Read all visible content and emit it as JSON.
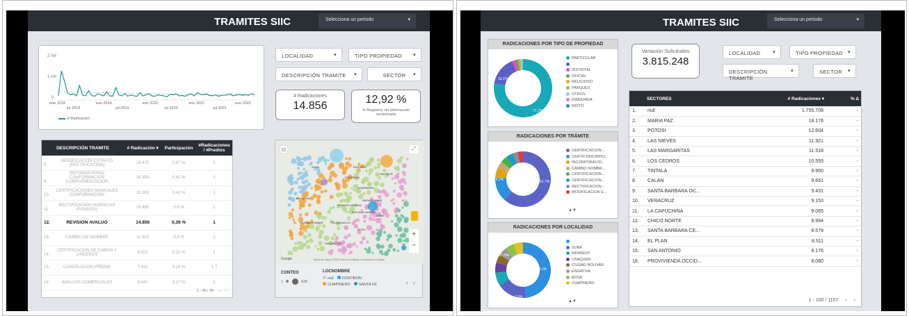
{
  "left": {
    "title": "TRAMITES SIIC",
    "period_placeholder": "Selecciona un periodo",
    "chart": {
      "y_ticks": [
        "2 mil",
        "1 mil",
        "0"
      ],
      "x_ticks": [
        "ene 2018",
        "ene 2019",
        "ene 2020",
        "ene 2021",
        "ene 2022"
      ],
      "x_ticks2": [
        "jul 2018",
        "jul 2019",
        "jul 2020",
        "jul 2021"
      ],
      "legend": "# Radicación",
      "series_color": "#1a9a8f"
    },
    "filters": {
      "localidad": "LOCALIDAD",
      "tipo": "TIPO PROPIEDAD",
      "descripcion": "DESCRIPCIÓN TRAMITE",
      "sector": "SECTOR"
    },
    "kpi1": {
      "label": "# Radicaciones",
      "value": "14.856"
    },
    "kpi2": {
      "value": "12,92 %",
      "label": "% Registros sin información sectorizada"
    },
    "table": {
      "headers": [
        "DESCRIPCIÓN TRAMITE",
        "# Radicación ▾",
        "Participación",
        "#Radicaciones / #Predios"
      ],
      "rows": [
        {
          "n": "8.",
          "d": "MODIFICACION ESTRATO (RECTIFICACION)",
          "r": "18.470",
          "p": "0,67 %",
          "x": "1",
          "hl": false
        },
        {
          "n": "9.",
          "d": "REFORMA PH/NO CONFORMACION COMPLEMENTACION",
          "r": "16.384",
          "p": "0,42 %",
          "x": "1",
          "hl": false
        },
        {
          "n": "10.",
          "d": "CERTIFICACIONES MANUALES CONFORMACION",
          "r": "15.309",
          "p": "0,42 %",
          "x": "1",
          "hl": false
        },
        {
          "n": "11.",
          "d": "RECTIFICACION VIGENCIAS (RANGOS)",
          "r": "15.465",
          "p": "0,4 %",
          "x": "1",
          "hl": false
        },
        {
          "n": "12.",
          "d": "REVISION AVALUO",
          "r": "14.856",
          "p": "0,39 %",
          "x": "1",
          "hl": true
        },
        {
          "n": "13.",
          "d": "CAMBIO DE NOMBRE",
          "r": "11.923",
          "p": "0,3 %",
          "x": "1",
          "hl": false
        },
        {
          "n": "14.",
          "d": "CERTIFICACION DE CABIDA Y LINDEROS",
          "r": "8.322",
          "p": "0,22 %",
          "x": "1",
          "hl": false
        },
        {
          "n": "15.",
          "d": "CANCELACION PREDIO",
          "r": "7.410",
          "p": "0,19 %",
          "x": "1,7",
          "hl": false
        },
        {
          "n": "16.",
          "d": "AVALUOS COMERCIALES",
          "r": "6.447",
          "p": "0,17 %",
          "x": "1",
          "hl": false
        }
      ],
      "pager": "1 - 36 / 36"
    },
    "map": {
      "labels": [
        "SUBA",
        "ENGATIVA",
        "FONTIBON",
        "KENNEDY",
        "PUENTE ARANDA",
        "TEUSAQUILLO",
        "CHAPINERO",
        "SANTA FE",
        "USME",
        "TUNJUELITO",
        "BOSA",
        "CIUDAD BOLIVAR",
        "ANTONIO NARIÑO",
        "RAFAEL URIBE"
      ],
      "conteo_label": "CONTEO",
      "conteo_min": "1",
      "conteo_max": "428",
      "locnombre_label": "LOCNOMBRE",
      "legend": [
        {
          "name": "null",
          "color": "#c8c8c8"
        },
        {
          "name": "FONTIBON",
          "color": "#2aa1d8"
        },
        {
          "name": "CHAPINERO",
          "color": "#f29b1f"
        },
        {
          "name": "SANTA FE",
          "color": "#1f9aa8"
        }
      ],
      "attribution": "Datos del mapa ©2023  Términos   Notificar un problema con Maps"
    }
  },
  "right": {
    "title": "TRAMITES SIIC",
    "period_placeholder": "Selecciona un periodo",
    "panel1": {
      "title": "RADICACIONES POR TIPO DE PROPIEDAD",
      "legend": [
        {
          "name": "PARTICULAR",
          "color": "#17a9b8"
        },
        {
          "name": "",
          "color": "#5a5fc8"
        },
        {
          "name": "DISTRITAL",
          "color": "#e04ec8"
        },
        {
          "name": "OFICIAL",
          "color": "#55b04a"
        },
        {
          "name": "RELIGIOSO",
          "color": "#e6a32e"
        },
        {
          "name": "PARQUES",
          "color": "#7ac36a"
        },
        {
          "name": "OTROS",
          "color": "#8bc8e8"
        },
        {
          "name": "EMBAJADA",
          "color": "#d97ad8"
        },
        {
          "name": "MIXTO",
          "color": "#2f7fd0"
        }
      ],
      "pct_big": "77,7%",
      "pct_small": "16,1%"
    },
    "panel2": {
      "title": "RADICACIONES POR TRÁMITE",
      "legend": [
        {
          "name": "CERTIFICACION...",
          "color": "#5b63c4"
        },
        {
          "name": "CERTIF.INSCRIPCI...",
          "color": "#2d8fe0"
        },
        {
          "name": "INCORPORACIO...",
          "color": "#e0a21c"
        },
        {
          "name": "CAMBIO NOMBR...",
          "color": "#c8a86a"
        },
        {
          "name": "CERTIFICACION...",
          "color": "#43b04a"
        },
        {
          "name": "CERTIFICACION...",
          "color": "#1f9ac8"
        },
        {
          "name": "RECTIFICACION...",
          "color": "#8a8f96"
        },
        {
          "name": "MODIFICACION E...",
          "color": "#e03b3b"
        }
      ],
      "pct_big": "61,7%",
      "pct_small": "14,2%",
      "pager": "▲▼"
    },
    "panel3": {
      "title": "RADICACIONES POR LOCALIDAD",
      "legend": [
        {
          "name": "",
          "color": "#2d8fe0"
        },
        {
          "name": "SUBA",
          "color": "#5b63c4"
        },
        {
          "name": "KENNEDY",
          "color": "#17a9b8"
        },
        {
          "name": "USAQUEN",
          "color": "#6a3fa8"
        },
        {
          "name": "CIUDAD BOLIVAR",
          "color": "#8a6a2a"
        },
        {
          "name": "ENGATIVA",
          "color": "#9a9a9a"
        },
        {
          "name": "BOSA",
          "color": "#8bc34a"
        },
        {
          "name": "CHAPINERO",
          "color": "#e0c020"
        }
      ],
      "pct_big": "48,2%",
      "pct_small1": "17,5%",
      "pct_small2": "7,8%",
      "pager": "▲▼"
    },
    "kpi": {
      "label": "Variación Solicitudes",
      "value": "3.815.248"
    },
    "filters": {
      "localidad": "LOCALIDAD",
      "tipo": "TIPO PROPIEDAD",
      "descripcion": "DESCRIPCIÓN TRÁMITE",
      "sector": "SECTOR"
    },
    "table": {
      "headers": [
        "SECTORES",
        "# Radicaciones ▾",
        "% Δ"
      ],
      "rows": [
        {
          "n": "1.",
          "s": "null",
          "v": "1.755.708",
          "d": "-"
        },
        {
          "n": "2.",
          "s": "MARIA PAZ",
          "v": "18.176",
          "d": "-"
        },
        {
          "n": "3.",
          "s": "POTOSI",
          "v": "12.604",
          "d": "-"
        },
        {
          "n": "4.",
          "s": "LAS NIEVES",
          "v": "11.921",
          "d": "-"
        },
        {
          "n": "5.",
          "s": "LAS MARGARITAS",
          "v": "11.518",
          "d": "-"
        },
        {
          "n": "6.",
          "s": "LOS CEDROS",
          "v": "10.555",
          "d": "-"
        },
        {
          "n": "7.",
          "s": "TINTALA",
          "v": "9.950",
          "d": "-"
        },
        {
          "n": "8.",
          "s": "CALAN",
          "v": "9.661",
          "d": "-"
        },
        {
          "n": "9.",
          "s": "SANTA BARBARA OC...",
          "v": "9.431",
          "d": "-"
        },
        {
          "n": "10.",
          "s": "VERACRUZ",
          "v": "9.153",
          "d": "-"
        },
        {
          "n": "11.",
          "s": "LA CAPUCHINA",
          "v": "9.065",
          "d": "-"
        },
        {
          "n": "12.",
          "s": "CHICO NORTE",
          "v": "8.994",
          "d": "-"
        },
        {
          "n": "13.",
          "s": "SANTA BARBARA CE...",
          "v": "8.578",
          "d": "-"
        },
        {
          "n": "14.",
          "s": "EL PLAN",
          "v": "8.511",
          "d": "-"
        },
        {
          "n": "15.",
          "s": "SAN ANTONIO",
          "v": "8.176",
          "d": "-"
        },
        {
          "n": "16.",
          "s": "PROVIVIENDA OCCID...",
          "v": "8.080",
          "d": "-"
        }
      ],
      "pager": "1 - 100 / 1107"
    }
  }
}
